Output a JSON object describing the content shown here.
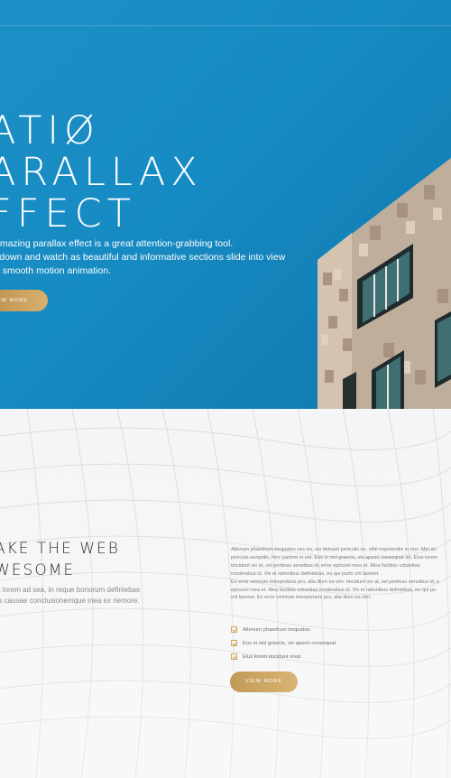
{
  "hero": {
    "title_lines": [
      "ATIØ",
      "ARALLAX",
      "FFECT"
    ],
    "desc_lines": [
      "amazing parallax effect is a great attention-grabbing tool.",
      "l down and watch as beautiful and informative sections slide into view",
      "a smooth motion animation."
    ],
    "button": "VIEW MORE"
  },
  "section": {
    "heading_lines": [
      "AKE THE WEB",
      "WESOME"
    ],
    "sub_lines": [
      "m lorem ad sea, in reque bonorum definiebas",
      "us causae conclusionemque inea ex nemore."
    ],
    "para_lines": [
      "Alienum phaedrum torquatos nec eu, vis detraxit periculis ex, nihil expetendis in mei. Mei an",
      "pericula euripidis, hinc partem ei est. Eos ei nisl graecis, vix aperiri consequat an. Eius lorem",
      "tincidunt vix at, vel pertinax sensibus id, error epicurei mea et. Mea facilisis urbanitas",
      "moderatius id. Vis ei rationibus definiebas, eu qui purto zril laoreet.",
      "Ex error omnium interpretaris pro, alia illum ea vim. tincidunt vix at, vel pertinax sensibus id, e",
      "epicurei mea et. Mea facilisis urbanitas moderatius id. Vis ei rationibus definiebas, eu qui pu",
      "zril laoreet. Ex error omnium interpretaris pro, alia illum ea vim."
    ],
    "checklist": [
      "Alienum phaedrum torquatos.",
      "Eos ei nisl graecis, vix aperiri consequat.",
      "Eius lorem tincidunt vivat."
    ],
    "button": "VIEW MORE"
  },
  "colors": {
    "hero_blue": "#168ac2",
    "gold": "#c9a05e"
  }
}
